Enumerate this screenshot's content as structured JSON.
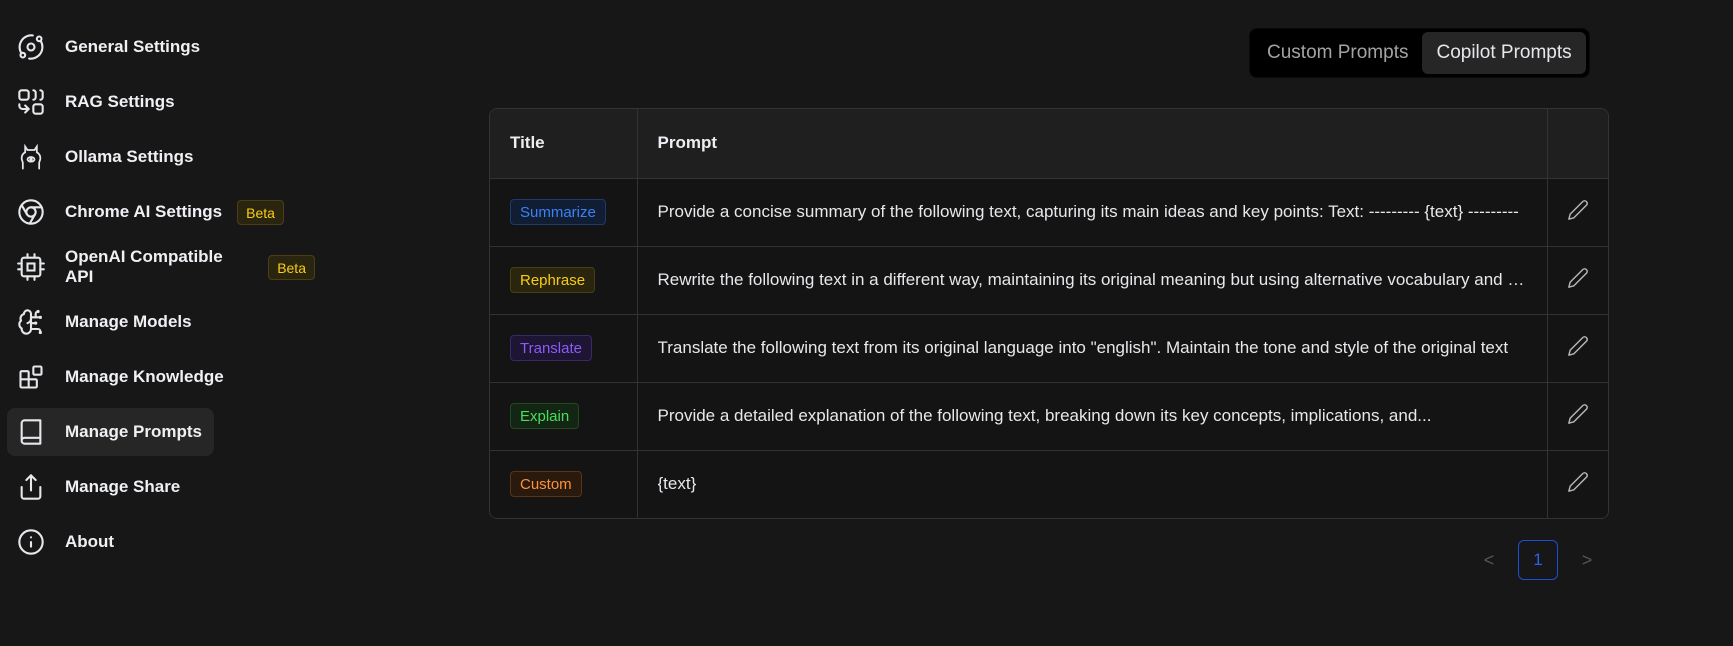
{
  "sidebar": {
    "items": [
      {
        "label": "General Settings",
        "icon": "orbit-icon"
      },
      {
        "label": "RAG Settings",
        "icon": "combine-icon"
      },
      {
        "label": "Ollama Settings",
        "icon": "ollama-icon"
      },
      {
        "label": "Chrome AI Settings",
        "icon": "chrome-icon",
        "badge": "Beta"
      },
      {
        "label": "OpenAI Compatible API",
        "icon": "cpu-icon",
        "badge": "Beta"
      },
      {
        "label": "Manage Models",
        "icon": "brain-circuit-icon"
      },
      {
        "label": "Manage Knowledge",
        "icon": "blocks-icon"
      },
      {
        "label": "Manage Prompts",
        "icon": "book-icon",
        "active": true
      },
      {
        "label": "Manage Share",
        "icon": "share-icon"
      },
      {
        "label": "About",
        "icon": "info-icon"
      }
    ]
  },
  "segmented": {
    "options": [
      "Custom Prompts",
      "Copilot Prompts"
    ],
    "selected": "Copilot Prompts"
  },
  "table": {
    "headers": {
      "title": "Title",
      "prompt": "Prompt",
      "actions": ""
    },
    "rows": [
      {
        "title": "Summarize",
        "color": "#3b82f6",
        "bg": "#111d33",
        "border": "#1e3a6b",
        "prompt": "Provide a concise summary of the following text, capturing its main ideas and key points: Text: --------- {text} ---------"
      },
      {
        "title": "Rephrase",
        "color": "#facc15",
        "bg": "#2a250f",
        "border": "#4a3f12",
        "prompt": "Rewrite the following text in a different way, maintaining its original meaning but using alternative vocabulary and sentence structures"
      },
      {
        "title": "Translate",
        "color": "#8b5cf6",
        "bg": "#1e1433",
        "border": "#3b2866",
        "prompt": "Translate the following text from its original language into \"english\". Maintain the tone and style of the original text"
      },
      {
        "title": "Explain",
        "color": "#4ade5a",
        "bg": "#132613",
        "border": "#23491f",
        "prompt": "Provide a detailed explanation of the following text, breaking down its key concepts, implications, and..."
      },
      {
        "title": "Custom",
        "color": "#fb923c",
        "bg": "#2a1a0e",
        "border": "#5a3416",
        "prompt": "{text}"
      }
    ]
  },
  "pagination": {
    "prev": "<",
    "current": "1",
    "next": ">"
  }
}
